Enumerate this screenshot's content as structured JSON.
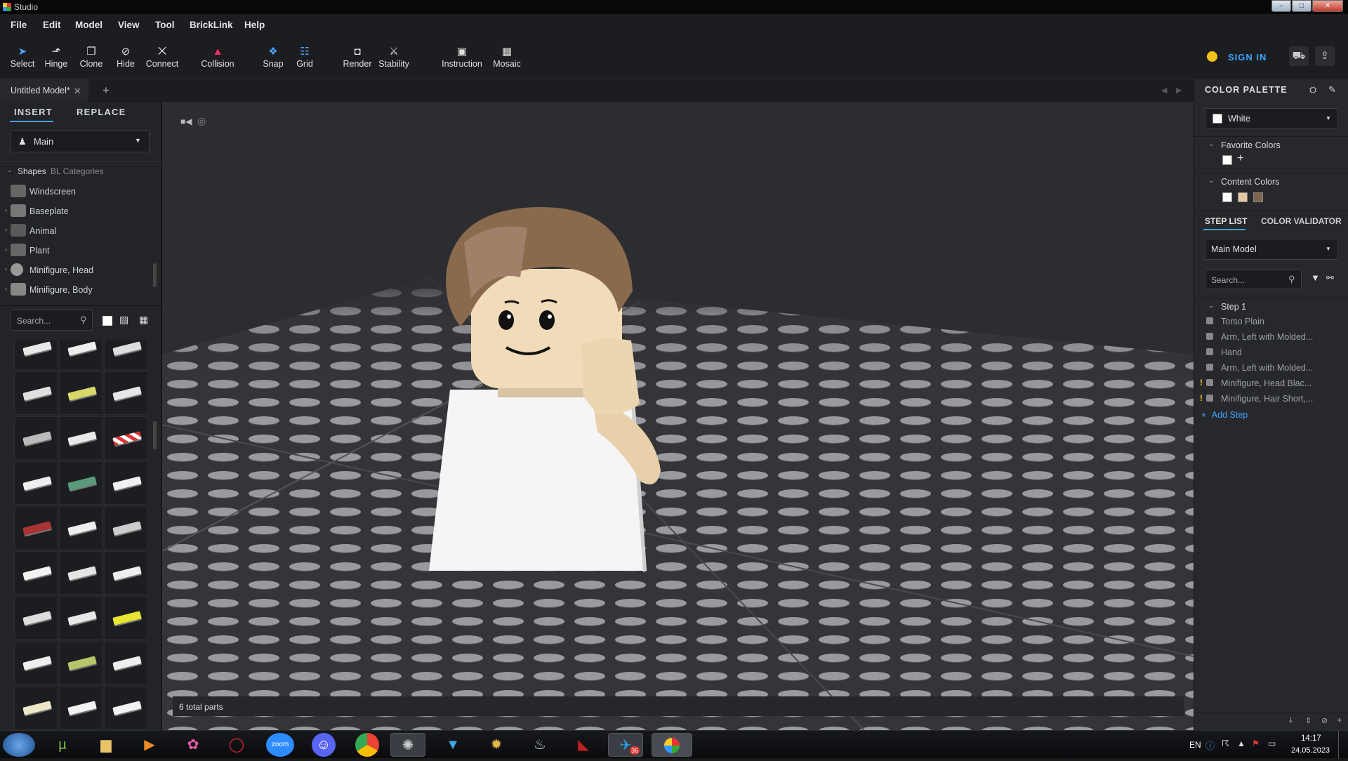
{
  "window": {
    "title": "Studio",
    "min": "–",
    "max": "□",
    "close": "✕"
  },
  "menu": [
    "File",
    "Edit",
    "Model",
    "View",
    "Tool",
    "BrickLink",
    "Help"
  ],
  "toolbar": [
    {
      "label": "Select",
      "icon": "cursor-icon",
      "glyph": "➤"
    },
    {
      "label": "Hinge",
      "icon": "hinge-icon",
      "glyph": "⬏"
    },
    {
      "label": "Clone",
      "icon": "clone-icon",
      "glyph": "❐"
    },
    {
      "label": "Hide",
      "icon": "hide-eye-icon",
      "glyph": "⊘"
    },
    {
      "label": "Connect",
      "icon": "connect-icon",
      "glyph": "⨉"
    },
    {
      "label": "Collision",
      "icon": "collision-icon",
      "glyph": "▲"
    },
    {
      "label": "Snap",
      "icon": "snap-icon",
      "glyph": "❖"
    },
    {
      "label": "Grid",
      "icon": "grid-icon",
      "glyph": "☷"
    },
    {
      "label": "Render",
      "icon": "camera-icon",
      "glyph": "◘"
    },
    {
      "label": "Stability",
      "icon": "stability-icon",
      "glyph": "⚔"
    },
    {
      "label": "Instruction",
      "icon": "instruction-icon",
      "glyph": "▣"
    },
    {
      "label": "Mosaic",
      "icon": "mosaic-icon",
      "glyph": "▦"
    }
  ],
  "account": {
    "sign_in": "SIGN IN"
  },
  "document_tab": {
    "label": "Untitled Model*",
    "close": "✕",
    "add": "+"
  },
  "left_panel": {
    "tabs": [
      "INSERT",
      "REPLACE"
    ],
    "palette_select": "Main",
    "subtabs": [
      "Shapes",
      "BL Categories"
    ],
    "categories": [
      "Windscreen",
      "Baseplate",
      "Animal",
      "Plant",
      "Minifigure, Head",
      "Minifigure, Body"
    ],
    "search_placeholder": "Search..."
  },
  "viewport": {
    "status": "6 total parts"
  },
  "right_panel": {
    "color_palette_title": "COLOR PALETTE",
    "selected_color": "White",
    "favorite_colors_label": "Favorite Colors",
    "favorite_colors": [
      "#ffffff"
    ],
    "content_colors_label": "Content Colors",
    "content_colors": [
      "#ffffff",
      "#e4c9a0",
      "#7d6349"
    ],
    "step_tabs": [
      "STEP LIST",
      "COLOR VALIDATOR"
    ],
    "model_select": "Main Model",
    "search_placeholder": "Search...",
    "step_title": "Step 1",
    "parts": [
      {
        "name": "Torso Plain",
        "warn": false
      },
      {
        "name": "Arm, Left with Molded...",
        "warn": false
      },
      {
        "name": "Hand",
        "warn": false
      },
      {
        "name": "Arm, Left with Molded...",
        "warn": false
      },
      {
        "name": "Minifigure, Head Blac...",
        "warn": true
      },
      {
        "name": "Minifigure, Hair Short,...",
        "warn": true
      }
    ],
    "add_step": "Add Step"
  },
  "taskbar": {
    "apps": [
      "start-orb-icon",
      "utorrent-icon",
      "file-explorer-icon",
      "media-player-icon",
      "photos-icon",
      "opera-icon",
      "zoom-icon",
      "discord-icon",
      "chrome-icon",
      "steelseries-icon",
      "vpn-icon",
      "hearthstone-icon",
      "steam-icon",
      "dota-icon",
      "telegram-icon",
      "studio-icon"
    ],
    "zoom_label": "zoom",
    "telegram_badge": "36",
    "lang": "EN",
    "time": "14:17",
    "date": "24.05.2023"
  }
}
